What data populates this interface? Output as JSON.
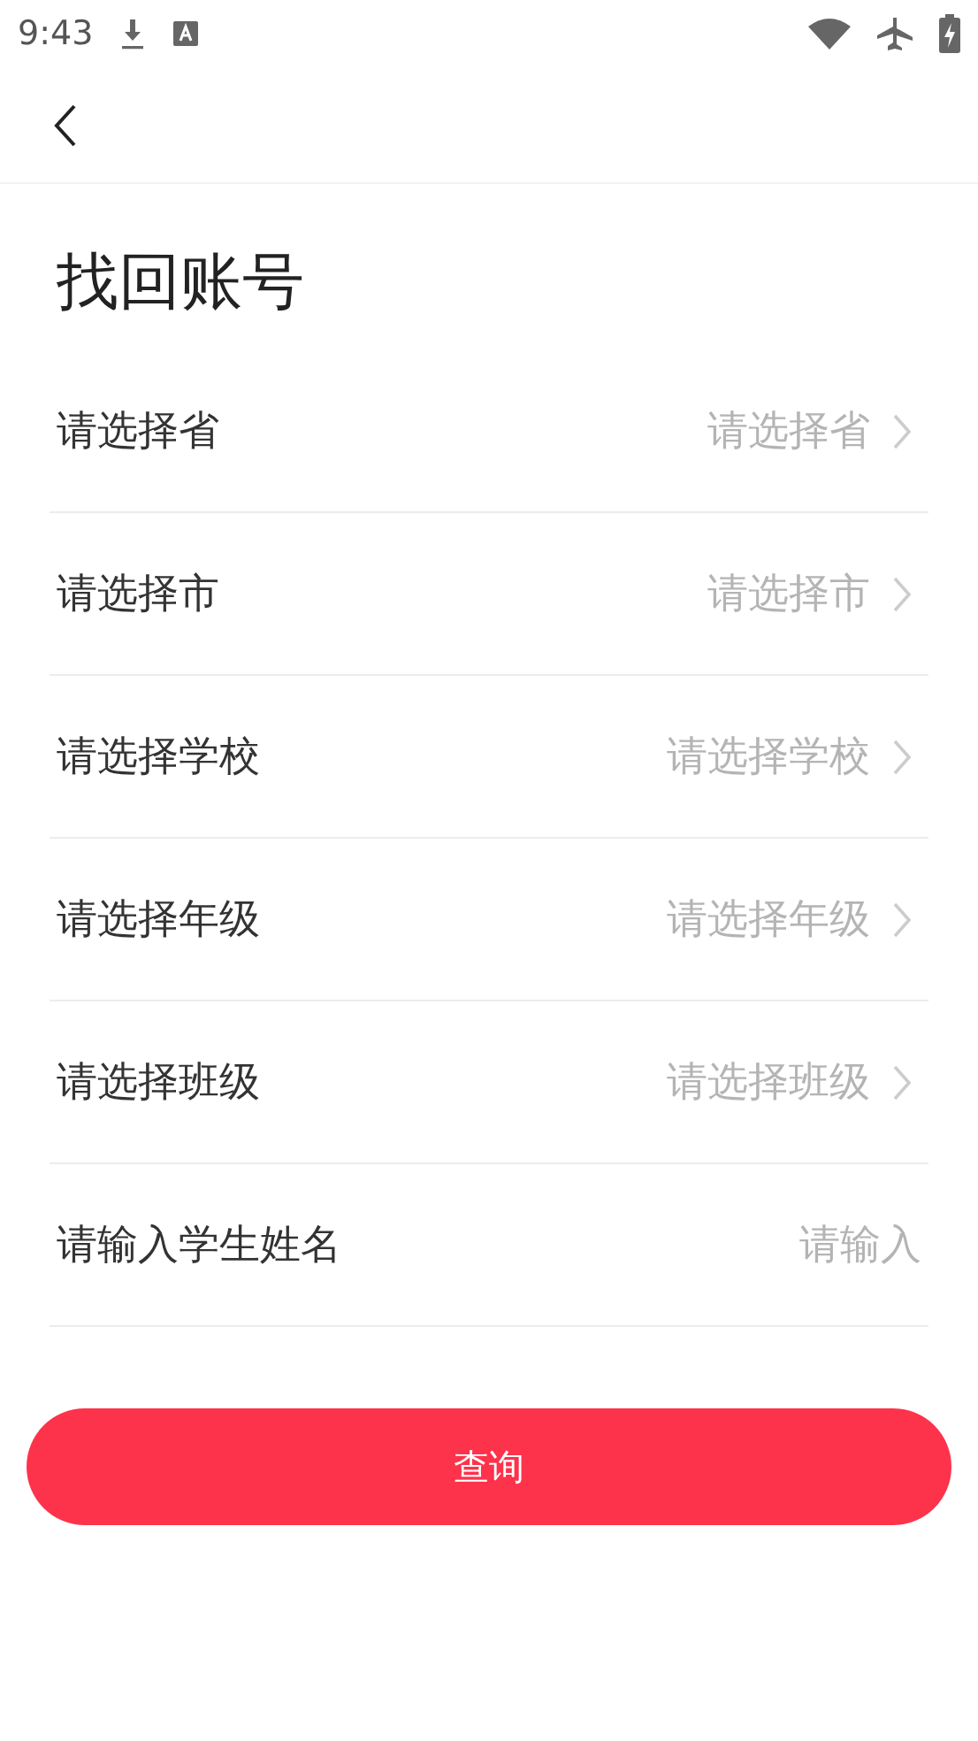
{
  "status_bar": {
    "time": "9:43"
  },
  "title": "找回账号",
  "rows": [
    {
      "kind": "select",
      "label": "请选择省",
      "placeholder": "请选择省"
    },
    {
      "kind": "select",
      "label": "请选择市",
      "placeholder": "请选择市"
    },
    {
      "kind": "select",
      "label": "请选择学校",
      "placeholder": "请选择学校"
    },
    {
      "kind": "select",
      "label": "请选择年级",
      "placeholder": "请选择年级"
    },
    {
      "kind": "select",
      "label": "请选择班级",
      "placeholder": "请选择班级"
    },
    {
      "kind": "input",
      "label": "请输入学生姓名",
      "placeholder": "请输入"
    }
  ],
  "button": "查询"
}
